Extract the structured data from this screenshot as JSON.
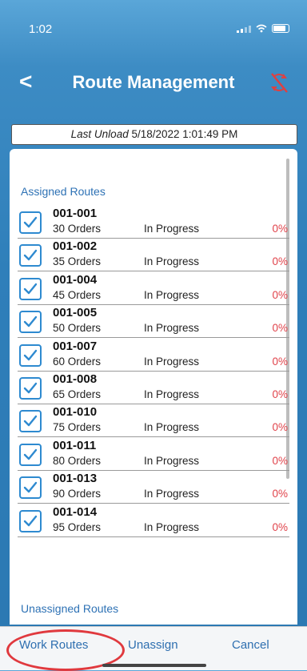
{
  "status_bar": {
    "time": "1:02"
  },
  "header": {
    "back_glyph": "<",
    "title": "Route Management",
    "sync_icon": "sync-off-icon"
  },
  "last_unload": {
    "label": "Last Unload",
    "value": "5/18/2022 1:01:49 PM"
  },
  "sections": {
    "assigned": "Assigned Routes",
    "unassigned": "Unassigned Routes"
  },
  "routes": [
    {
      "code": "001-001",
      "orders": "30 Orders",
      "status": "In Progress",
      "percent": "0%",
      "checked": true
    },
    {
      "code": "001-002",
      "orders": "35 Orders",
      "status": "In Progress",
      "percent": "0%",
      "checked": true
    },
    {
      "code": "001-004",
      "orders": "45 Orders",
      "status": "In Progress",
      "percent": "0%",
      "checked": true
    },
    {
      "code": "001-005",
      "orders": "50 Orders",
      "status": "In Progress",
      "percent": "0%",
      "checked": true
    },
    {
      "code": "001-007",
      "orders": "60 Orders",
      "status": "In Progress",
      "percent": "0%",
      "checked": true
    },
    {
      "code": "001-008",
      "orders": "65 Orders",
      "status": "In Progress",
      "percent": "0%",
      "checked": true
    },
    {
      "code": "001-010",
      "orders": "75 Orders",
      "status": "In Progress",
      "percent": "0%",
      "checked": true
    },
    {
      "code": "001-011",
      "orders": "80 Orders",
      "status": "In Progress",
      "percent": "0%",
      "checked": true
    },
    {
      "code": "001-013",
      "orders": "90 Orders",
      "status": "In Progress",
      "percent": "0%",
      "checked": true
    },
    {
      "code": "001-014",
      "orders": "95 Orders",
      "status": "In Progress",
      "percent": "0%",
      "checked": true
    }
  ],
  "actions": {
    "work_routes": "Work Routes",
    "unassign": "Unassign",
    "cancel": "Cancel"
  },
  "colors": {
    "accent": "#2e72b5",
    "percent": "#e0424a",
    "highlight": "#e0393e"
  }
}
